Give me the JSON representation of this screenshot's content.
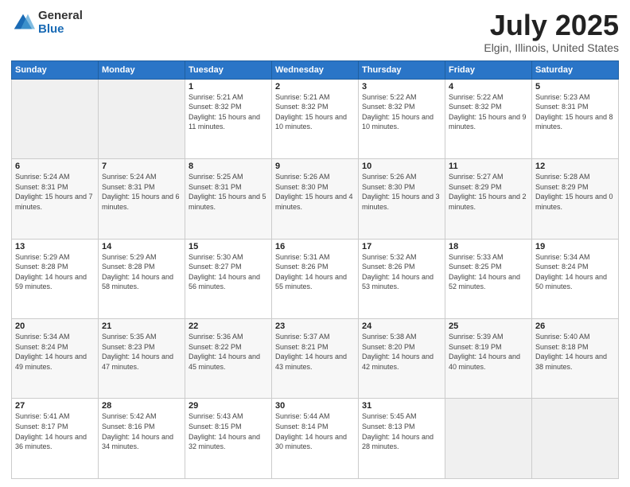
{
  "logo": {
    "general": "General",
    "blue": "Blue"
  },
  "header": {
    "month": "July 2025",
    "location": "Elgin, Illinois, United States"
  },
  "weekdays": [
    "Sunday",
    "Monday",
    "Tuesday",
    "Wednesday",
    "Thursday",
    "Friday",
    "Saturday"
  ],
  "weeks": [
    [
      {
        "day": "",
        "info": ""
      },
      {
        "day": "",
        "info": ""
      },
      {
        "day": "1",
        "info": "Sunrise: 5:21 AM\nSunset: 8:32 PM\nDaylight: 15 hours and 11 minutes."
      },
      {
        "day": "2",
        "info": "Sunrise: 5:21 AM\nSunset: 8:32 PM\nDaylight: 15 hours and 10 minutes."
      },
      {
        "day": "3",
        "info": "Sunrise: 5:22 AM\nSunset: 8:32 PM\nDaylight: 15 hours and 10 minutes."
      },
      {
        "day": "4",
        "info": "Sunrise: 5:22 AM\nSunset: 8:32 PM\nDaylight: 15 hours and 9 minutes."
      },
      {
        "day": "5",
        "info": "Sunrise: 5:23 AM\nSunset: 8:31 PM\nDaylight: 15 hours and 8 minutes."
      }
    ],
    [
      {
        "day": "6",
        "info": "Sunrise: 5:24 AM\nSunset: 8:31 PM\nDaylight: 15 hours and 7 minutes."
      },
      {
        "day": "7",
        "info": "Sunrise: 5:24 AM\nSunset: 8:31 PM\nDaylight: 15 hours and 6 minutes."
      },
      {
        "day": "8",
        "info": "Sunrise: 5:25 AM\nSunset: 8:31 PM\nDaylight: 15 hours and 5 minutes."
      },
      {
        "day": "9",
        "info": "Sunrise: 5:26 AM\nSunset: 8:30 PM\nDaylight: 15 hours and 4 minutes."
      },
      {
        "day": "10",
        "info": "Sunrise: 5:26 AM\nSunset: 8:30 PM\nDaylight: 15 hours and 3 minutes."
      },
      {
        "day": "11",
        "info": "Sunrise: 5:27 AM\nSunset: 8:29 PM\nDaylight: 15 hours and 2 minutes."
      },
      {
        "day": "12",
        "info": "Sunrise: 5:28 AM\nSunset: 8:29 PM\nDaylight: 15 hours and 0 minutes."
      }
    ],
    [
      {
        "day": "13",
        "info": "Sunrise: 5:29 AM\nSunset: 8:28 PM\nDaylight: 14 hours and 59 minutes."
      },
      {
        "day": "14",
        "info": "Sunrise: 5:29 AM\nSunset: 8:28 PM\nDaylight: 14 hours and 58 minutes."
      },
      {
        "day": "15",
        "info": "Sunrise: 5:30 AM\nSunset: 8:27 PM\nDaylight: 14 hours and 56 minutes."
      },
      {
        "day": "16",
        "info": "Sunrise: 5:31 AM\nSunset: 8:26 PM\nDaylight: 14 hours and 55 minutes."
      },
      {
        "day": "17",
        "info": "Sunrise: 5:32 AM\nSunset: 8:26 PM\nDaylight: 14 hours and 53 minutes."
      },
      {
        "day": "18",
        "info": "Sunrise: 5:33 AM\nSunset: 8:25 PM\nDaylight: 14 hours and 52 minutes."
      },
      {
        "day": "19",
        "info": "Sunrise: 5:34 AM\nSunset: 8:24 PM\nDaylight: 14 hours and 50 minutes."
      }
    ],
    [
      {
        "day": "20",
        "info": "Sunrise: 5:34 AM\nSunset: 8:24 PM\nDaylight: 14 hours and 49 minutes."
      },
      {
        "day": "21",
        "info": "Sunrise: 5:35 AM\nSunset: 8:23 PM\nDaylight: 14 hours and 47 minutes."
      },
      {
        "day": "22",
        "info": "Sunrise: 5:36 AM\nSunset: 8:22 PM\nDaylight: 14 hours and 45 minutes."
      },
      {
        "day": "23",
        "info": "Sunrise: 5:37 AM\nSunset: 8:21 PM\nDaylight: 14 hours and 43 minutes."
      },
      {
        "day": "24",
        "info": "Sunrise: 5:38 AM\nSunset: 8:20 PM\nDaylight: 14 hours and 42 minutes."
      },
      {
        "day": "25",
        "info": "Sunrise: 5:39 AM\nSunset: 8:19 PM\nDaylight: 14 hours and 40 minutes."
      },
      {
        "day": "26",
        "info": "Sunrise: 5:40 AM\nSunset: 8:18 PM\nDaylight: 14 hours and 38 minutes."
      }
    ],
    [
      {
        "day": "27",
        "info": "Sunrise: 5:41 AM\nSunset: 8:17 PM\nDaylight: 14 hours and 36 minutes."
      },
      {
        "day": "28",
        "info": "Sunrise: 5:42 AM\nSunset: 8:16 PM\nDaylight: 14 hours and 34 minutes."
      },
      {
        "day": "29",
        "info": "Sunrise: 5:43 AM\nSunset: 8:15 PM\nDaylight: 14 hours and 32 minutes."
      },
      {
        "day": "30",
        "info": "Sunrise: 5:44 AM\nSunset: 8:14 PM\nDaylight: 14 hours and 30 minutes."
      },
      {
        "day": "31",
        "info": "Sunrise: 5:45 AM\nSunset: 8:13 PM\nDaylight: 14 hours and 28 minutes."
      },
      {
        "day": "",
        "info": ""
      },
      {
        "day": "",
        "info": ""
      }
    ]
  ]
}
